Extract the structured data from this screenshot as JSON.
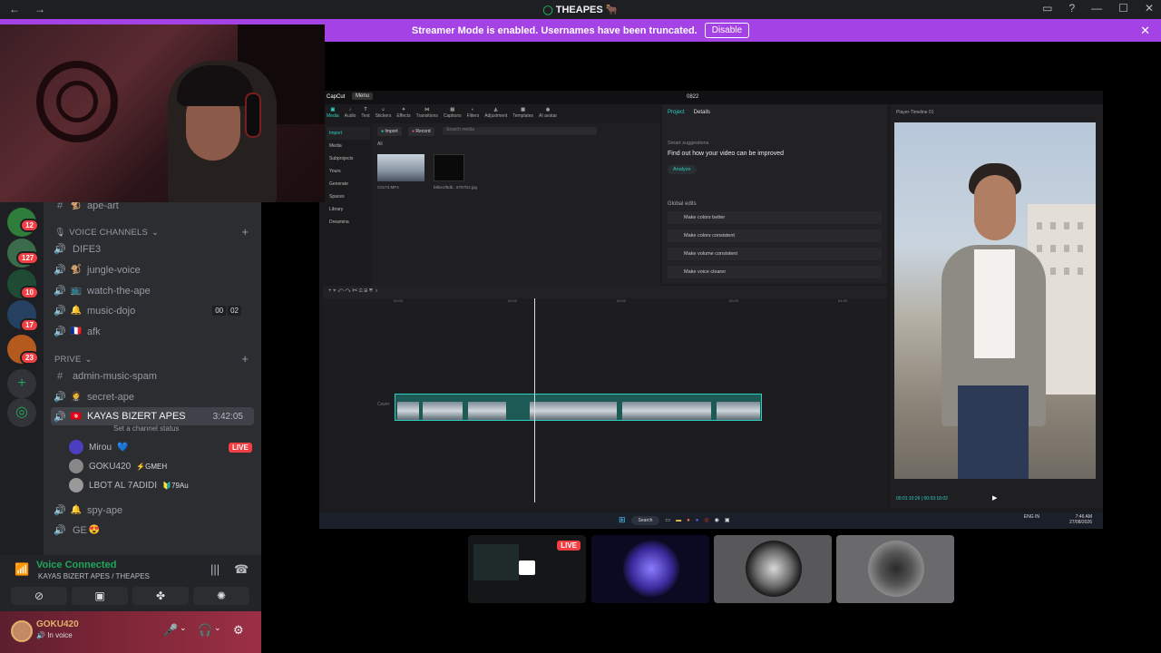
{
  "window": {
    "title": "THEAPES",
    "title_emoji": "🐂",
    "back": "←",
    "forward": "→"
  },
  "banner": {
    "text": "Streamer Mode is enabled. Usernames have been truncated.",
    "button": "Disable"
  },
  "servers": {
    "badges": [
      "12",
      "127",
      "10",
      "17",
      "23"
    ]
  },
  "channels": {
    "top_channel": "ape-art",
    "voice_category": "VOICE CHANNELS",
    "voice": [
      {
        "name": "DIFE3",
        "emoji": ""
      },
      {
        "name": "jungle-voice",
        "emoji": "🐒"
      },
      {
        "name": "watch-the-ape",
        "emoji": "📺"
      },
      {
        "name": "music-dojo",
        "emoji": "🔔",
        "counts": [
          "00",
          "02"
        ]
      },
      {
        "name": "afk",
        "emoji": "🇫🇷"
      }
    ],
    "prive_category": "PRIVE",
    "prive": [
      {
        "name": "admin-music-spam",
        "type": "text"
      },
      {
        "name": "secret-ape",
        "emoji": "🤵"
      }
    ],
    "active_channel": {
      "name": "KAYAS BIZERT APES",
      "emoji": "🇹🇳",
      "time": "3:42:05",
      "status": "Set a channel status"
    },
    "members": [
      {
        "name": "Mirou",
        "suffix": "💙",
        "live": "LIVE"
      },
      {
        "name": "GOKU420",
        "tag": "⚡GMEH"
      },
      {
        "name": "LBOT AL 7ADIDI",
        "tag": "🔰79Au"
      }
    ],
    "after": [
      {
        "name": "spy-ape",
        "emoji": "🔔"
      },
      {
        "name": "GE",
        "emoji": "😍"
      }
    ]
  },
  "voice_panel": {
    "title": "Voice Connected",
    "sub": "KAYAS BIZERT APES / THEAPES"
  },
  "user_panel": {
    "name": "GOKU420",
    "status": "In voice"
  },
  "capcut": {
    "logo": "CapCut",
    "menu": "Menu",
    "project_id": "0822",
    "tools": [
      "Media",
      "Audio",
      "Text",
      "Stickers",
      "Effects",
      "Transitions",
      "Captions",
      "Filters",
      "Adjustment",
      "Templates",
      "AI avatar"
    ],
    "sidebar": [
      "Import",
      "Media",
      "Subprojects",
      "Yours",
      "Generate",
      "Spaces",
      "Library",
      "Dreamina"
    ],
    "import_btn": "Import",
    "record_btn": "Record",
    "search_placeholder": "Search media",
    "filter_all": "All",
    "thumb1_label": "C0173.MP4",
    "thumb2_label": "b8be1f9db...9787D2.jpg",
    "tabs": [
      "Project",
      "Details"
    ],
    "smart": "Smart suggestions",
    "find": "Find out how your video can be improved",
    "analyze": "Analyze",
    "global_edits": "Global edits",
    "edits": [
      "Make colors better",
      "Make colors consistent",
      "Make volume consistent",
      "Make voice clearer"
    ],
    "player_label": "Player-Timeline 01",
    "time_readout": "00:01:10:26 | 00:03:18:02",
    "ruler": [
      "00:00",
      "00:00",
      "00:00",
      "00:00",
      "04:00"
    ],
    "cover": "Cover"
  },
  "taskbar": {
    "search": "Search",
    "lang": "ENG IN",
    "time": "7:46 AM",
    "date": "27/08/2026"
  },
  "tiles": {
    "live": "LIVE"
  }
}
